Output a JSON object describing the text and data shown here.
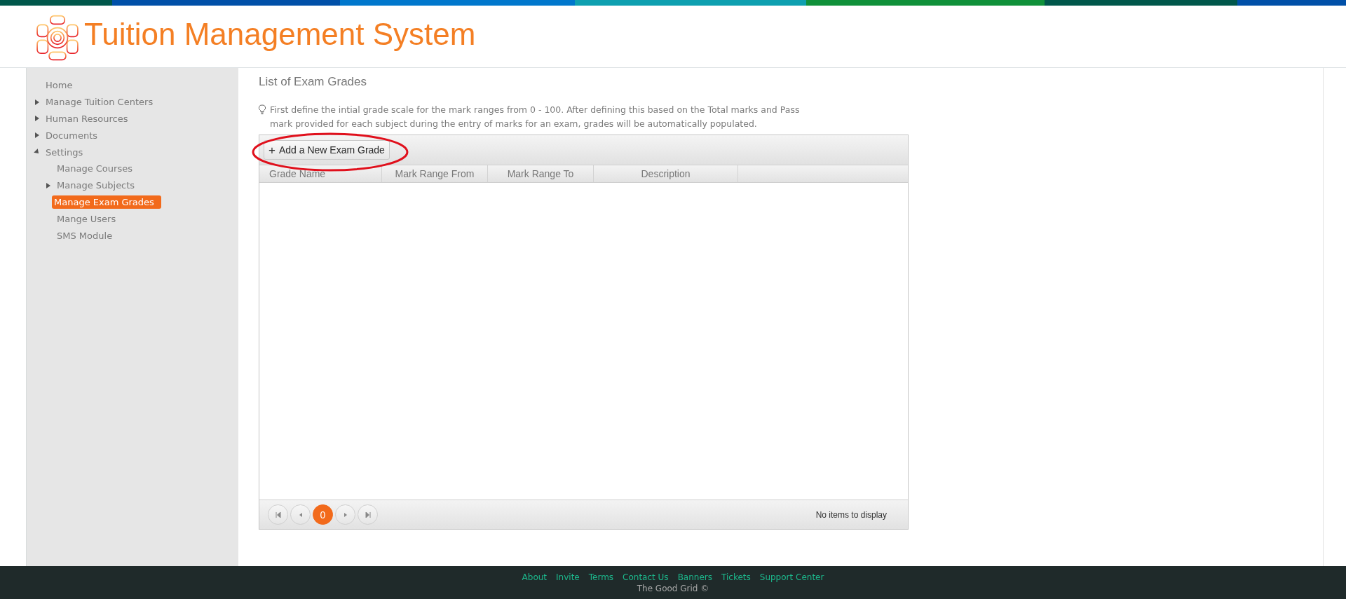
{
  "header": {
    "title": "Tuition Management System"
  },
  "sidebar": {
    "items": [
      {
        "label": "Home",
        "kind": "link",
        "selected": false
      },
      {
        "label": "Manage Tuition Centers",
        "kind": "folder",
        "expanded": false,
        "selected": false
      },
      {
        "label": "Human Resources",
        "kind": "folder",
        "expanded": false,
        "selected": false
      },
      {
        "label": "Documents",
        "kind": "folder",
        "expanded": false,
        "selected": false
      },
      {
        "label": "Settings",
        "kind": "folder",
        "expanded": true,
        "selected": false,
        "children": [
          {
            "label": "Manage Courses",
            "kind": "link",
            "selected": false
          },
          {
            "label": "Manage Subjects",
            "kind": "folder",
            "expanded": false,
            "selected": false
          },
          {
            "label": "Manage Exam Grades",
            "kind": "link",
            "selected": true
          },
          {
            "label": "Mange Users",
            "kind": "link",
            "selected": false
          },
          {
            "label": "SMS Module",
            "kind": "link",
            "selected": false
          }
        ]
      }
    ]
  },
  "page": {
    "title": "List of Exam Grades",
    "hint": "First define the intial grade scale for the mark ranges from 0 - 100. After defining this based on the Total marks and Pass mark provided for each subject during the entry of marks for an exam, grades will be automatically populated."
  },
  "grid": {
    "toolbar_button": {
      "icon": "+",
      "label": "Add a New Exam Grade",
      "annotated": true
    },
    "columns": [
      "Grade Name",
      "Mark Range From",
      "Mark Range To",
      "Description"
    ],
    "pager": {
      "pages": [
        {
          "label": "0",
          "selected": true
        }
      ],
      "status": "No items to display"
    }
  },
  "footer": {
    "links": [
      "About",
      "Invite",
      "Terms",
      "Contact Us",
      "Banners",
      "Tickets",
      "Support Center"
    ],
    "copyright": "The Good Grid ©"
  }
}
